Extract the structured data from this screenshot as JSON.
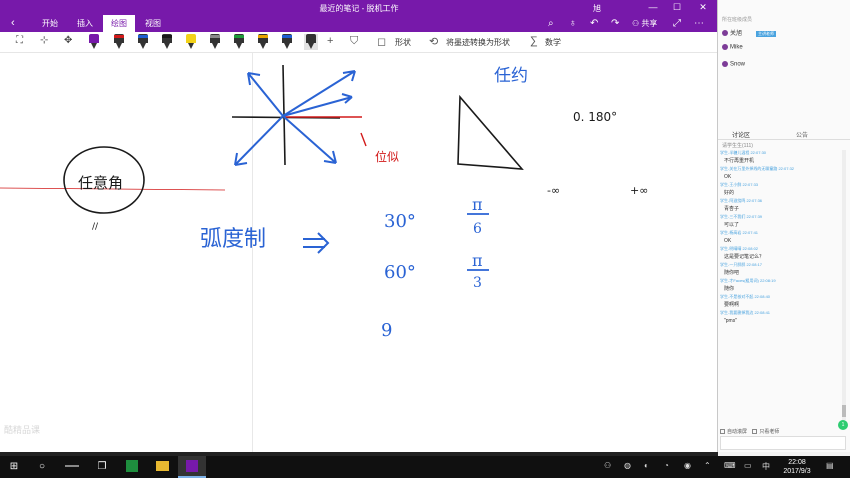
{
  "window": {
    "title": "最近的笔记 - 脱机工作",
    "user": "旭",
    "min_glyph": "—",
    "max_glyph": "☐",
    "close_glyph": "✕"
  },
  "ribbon": {
    "back_glyph": "‹",
    "tabs": [
      "开始",
      "插入",
      "绘图",
      "视图"
    ],
    "active_tab": "绘图",
    "share_label": "共享"
  },
  "draw_toolbar": {
    "shapes_label": "形状",
    "ink_to_shape_label": "将墨迹转换为形状",
    "math_label": "数学",
    "pen_colors": [
      "#7719aa",
      "#d21a1a",
      "#1f5fd1",
      "#1a1a1a",
      "#f2d21a",
      "#8a8a8a",
      "#1f9a3a",
      "#e8a400",
      "#1f5fd1",
      "#1a1a1a"
    ]
  },
  "canvas": {
    "handwriting": {
      "arbitrary_angle": "任意角",
      "degree_system": "位似",
      "radian": "弧度制",
      "arrow": "⇒",
      "any": "任约",
      "range": "0. 180°",
      "neg_inf": "-∞",
      "pos_inf": "+∞",
      "deg30": "30°",
      "deg60": "60°",
      "deg90": "9",
      "pi6_num": "π",
      "pi6_den": "6",
      "pi3_num": "π",
      "pi3_den": "3",
      "dash": "-",
      "ticks": "//"
    },
    "ink_colors": {
      "blue": "#2a63d4",
      "black": "#1a1a1a",
      "red": "#d21a1a"
    }
  },
  "watermark": "酷精品课",
  "side_panel": {
    "header": "所在班级成员",
    "members": [
      {
        "name": "关旭",
        "tag": "主讲老师"
      },
      {
        "name": "Mike",
        "tag": ""
      },
      {
        "name": "Snow",
        "tag": ""
      }
    ],
    "tabs": [
      "讨论区",
      "公告"
    ],
    "filter": "请学生生(111)",
    "messages": [
      {
        "meta": "学生-半糖儿温程 22:07:30",
        "body": "不行再重开机"
      },
      {
        "meta": "学生-关在万里外掉线的无聊童路 22:07:32",
        "body": "OK"
      },
      {
        "meta": "学生-王小鲜 22:07:33",
        "body": "好的"
      },
      {
        "meta": "学生-阿滋绕鸣 22:07:36",
        "body": "青杏子"
      },
      {
        "meta": "学生-三不我们 22:07:39",
        "body": "可以了"
      },
      {
        "meta": "学生-杨高岩 22:07:41",
        "body": "OK"
      },
      {
        "meta": "学生-明晴晴 22:08:02",
        "body": "这是要记笔记么？"
      },
      {
        "meta": "学生-一只胖胖 22:08:17",
        "body": "随你吧"
      },
      {
        "meta": "学生-才Faces(粗用词) 22:08:19",
        "body": "随你"
      },
      {
        "meta": "学生-不是核对不起 22:08:40",
        "body": "要啊啊"
      },
      {
        "meta": "学生-我要删掉我边 22:08:41",
        "body": "\"pms\""
      }
    ],
    "auto_scroll_label": "自动滚屏",
    "only_teacher_label": "只看老师",
    "badge": "1"
  },
  "taskbar": {
    "time": "22:08",
    "date": "2017/9/3",
    "ime": "中",
    "start_glyph": "⊞",
    "search_glyph": "○",
    "taskview_glyph": "❐"
  }
}
